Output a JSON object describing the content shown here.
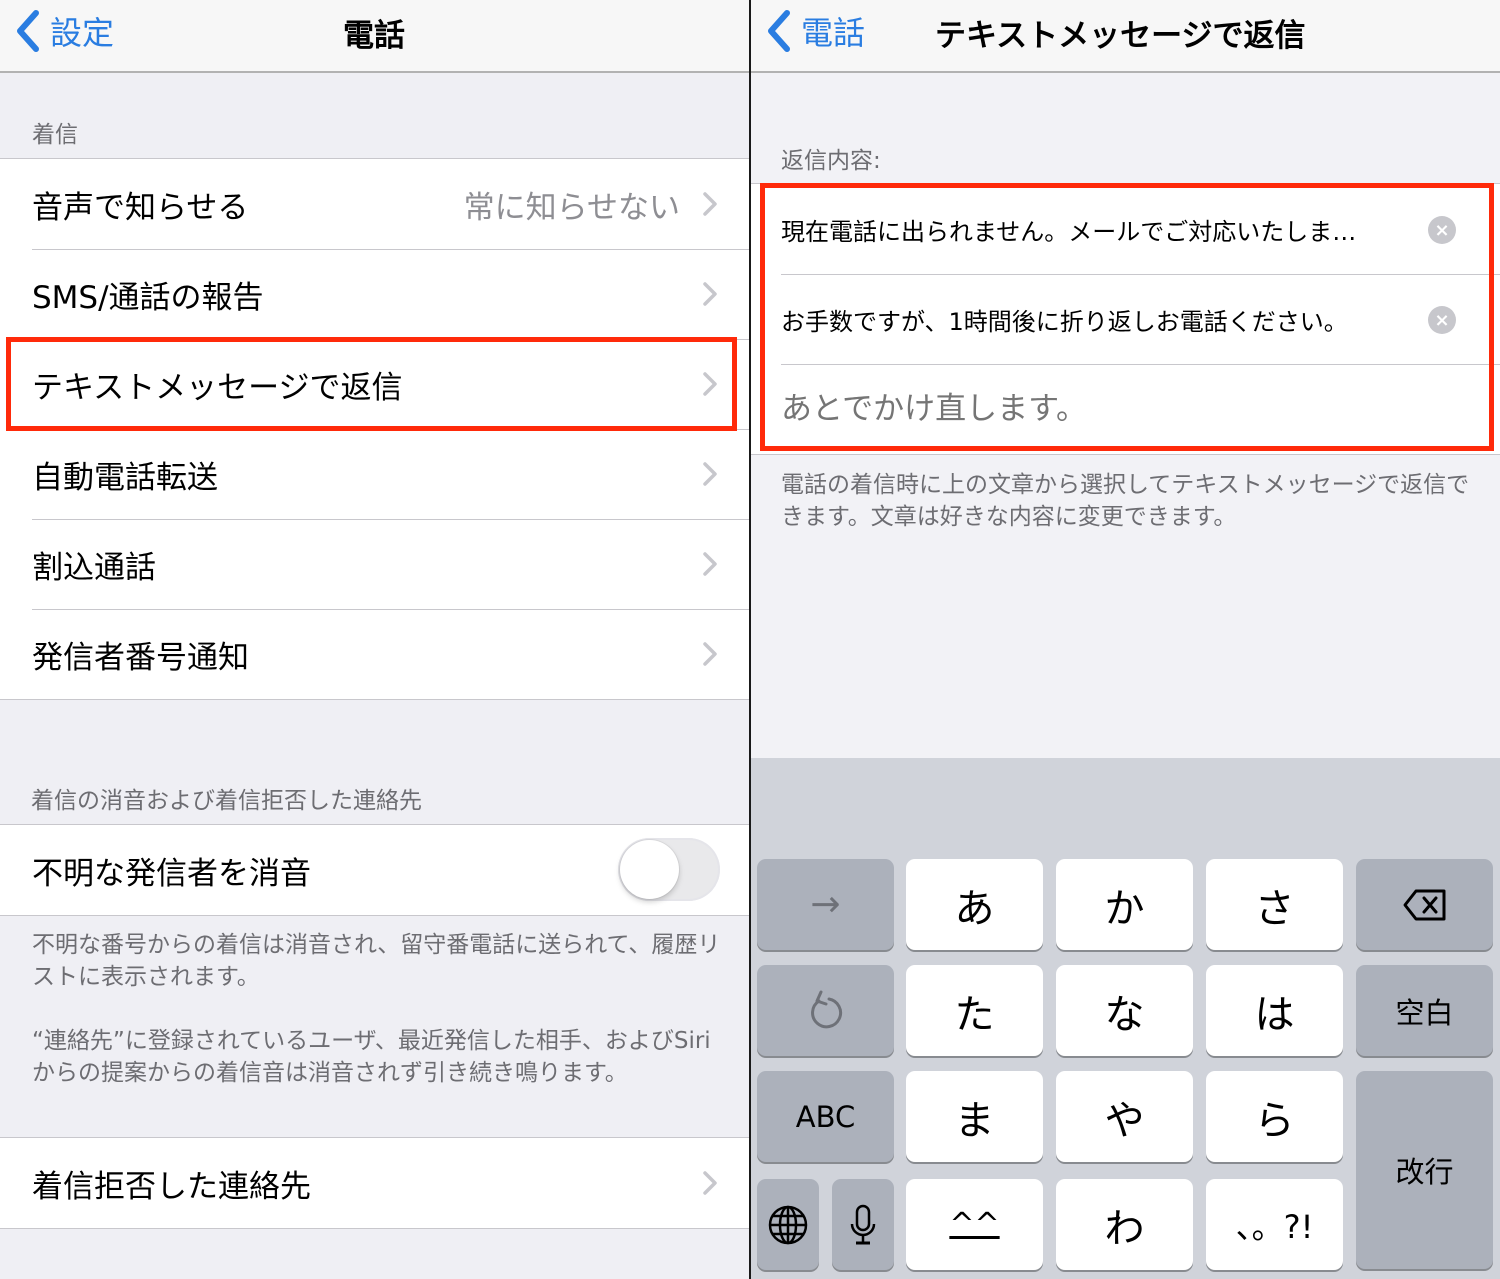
{
  "left": {
    "nav": {
      "back_label": "設定",
      "title": "電話"
    },
    "section1_header": "着信",
    "rows": [
      {
        "label": "音声で知らせる",
        "value": "常に知らせない"
      },
      {
        "label": "SMS/通話の報告",
        "value": ""
      },
      {
        "label": "テキストメッセージで返信",
        "value": ""
      },
      {
        "label": "自動電話転送",
        "value": ""
      },
      {
        "label": "割込通話",
        "value": ""
      },
      {
        "label": "発信者番号通知",
        "value": ""
      }
    ],
    "section2_header": "着信の消音および着信拒否した連絡先",
    "silence_row": {
      "label": "不明な発信者を消音",
      "toggle_on": false
    },
    "footer1": "不明な番号からの着信は消音され、留守番電話に送られて、履歴リストに表示されます。",
    "footer2": "“連絡先”に登録されているユーザ、最近発信した相手、およびSiriからの提案からの着信音は消音されず引き続き鳴ります。",
    "blocked_row": {
      "label": "着信拒否した連絡先"
    }
  },
  "right": {
    "nav": {
      "back_label": "電話",
      "title": "テキストメッセージで返信"
    },
    "section_header": "返信内容:",
    "replies": [
      {
        "value": "現在電話に出られません。メールでご対応いたしま…",
        "placeholder": ""
      },
      {
        "value": "お手数ですが、1時間後に折り返しお電話ください。",
        "placeholder": ""
      },
      {
        "value": "",
        "placeholder": "あとでかけ直します。"
      }
    ],
    "footer": "電話の着信時に上の文章から選択してテキストメッセージで返信できます。文章は好きな内容に変更できます。",
    "keyboard": {
      "arrow": "→",
      "keys": [
        "あ",
        "か",
        "さ",
        "た",
        "な",
        "は",
        "ま",
        "や",
        "ら",
        "^^",
        "わ",
        "、。?!"
      ],
      "space": "空白",
      "abc": "ABC",
      "enter": "改行"
    }
  },
  "colors": {
    "accent": "#2a7de1",
    "highlight": "#ff2a0a"
  }
}
